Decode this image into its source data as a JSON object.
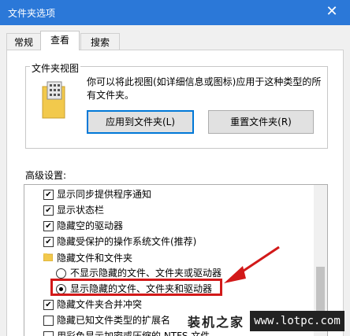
{
  "window": {
    "title": "文件夹选项",
    "close_glyph": "✕"
  },
  "tabs": [
    {
      "label": "常规"
    },
    {
      "label": "查看"
    },
    {
      "label": "搜索"
    }
  ],
  "folder_views": {
    "title": "文件夹视图",
    "description": "你可以将此视图(如详细信息或图标)应用于这种类型的所有文件夹。",
    "apply_label": "应用到文件夹(L)",
    "reset_label": "重置文件夹(R)"
  },
  "advanced": {
    "label": "高级设置:",
    "items": [
      {
        "label": "显示同步提供程序通知",
        "kind": "checkbox",
        "checked": true
      },
      {
        "label": "显示状态栏",
        "kind": "checkbox",
        "checked": true
      },
      {
        "label": "隐藏空的驱动器",
        "kind": "checkbox",
        "checked": true
      },
      {
        "label": "隐藏受保护的操作系统文件(推荐)",
        "kind": "checkbox",
        "checked": true
      },
      {
        "label": "隐藏文件和文件夹",
        "kind": "folder"
      },
      {
        "label": "不显示隐藏的文件、文件夹或驱动器",
        "kind": "radio",
        "checked": false
      },
      {
        "label": "显示隐藏的文件、文件夹和驱动器",
        "kind": "radio",
        "checked": true
      },
      {
        "label": "隐藏文件夹合并冲突",
        "kind": "checkbox",
        "checked": true
      },
      {
        "label": "隐藏已知文件类型的扩展名",
        "kind": "checkbox",
        "checked": false
      },
      {
        "label": "用彩色显示加密或压缩的 NTFS 文件",
        "kind": "checkbox",
        "checked": false
      }
    ]
  },
  "watermark": {
    "text": "装机之家",
    "site": "www.lotpc.com"
  },
  "colors": {
    "title_bar": "#2b78d8",
    "highlight": "#d21919"
  }
}
